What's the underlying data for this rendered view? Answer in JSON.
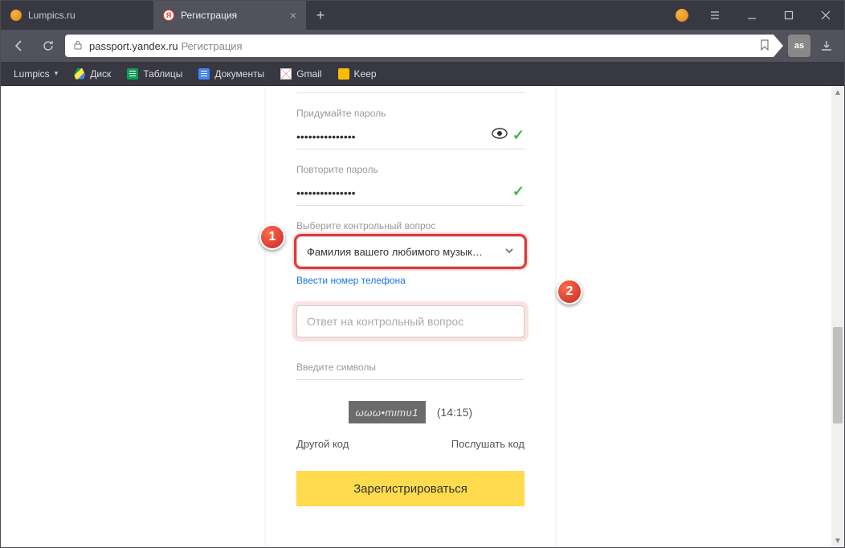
{
  "tabs": [
    {
      "title": "Lumpics.ru"
    },
    {
      "title": "Регистрация"
    }
  ],
  "url": {
    "host": "passport.yandex.ru",
    "path": "Регистрация"
  },
  "extension_label": "as",
  "bookmarks": {
    "folder": "Lumpics",
    "items": [
      {
        "label": "Диск"
      },
      {
        "label": "Таблицы"
      },
      {
        "label": "Документы"
      },
      {
        "label": "Gmail"
      },
      {
        "label": "Keep"
      }
    ]
  },
  "form": {
    "password_label": "Придумайте пароль",
    "password_value": "•••••••••••••••",
    "repeat_label": "Повторите пароль",
    "repeat_value": "•••••••••••••••",
    "question_label": "Выберите контрольный вопрос",
    "question_selected": "Фамилия вашего любимого музык…",
    "phone_link": "Ввести номер телефона",
    "answer_placeholder": "Ответ на контрольный вопрос",
    "captcha_label": "Введите символы",
    "captcha_text": "ωωω•тιтυ1",
    "captcha_time": "(14:15)",
    "captcha_other": "Другой код",
    "captcha_listen": "Послушать код",
    "submit": "Зарегистрироваться"
  },
  "annotations": {
    "badge1": "1",
    "badge2": "2"
  }
}
